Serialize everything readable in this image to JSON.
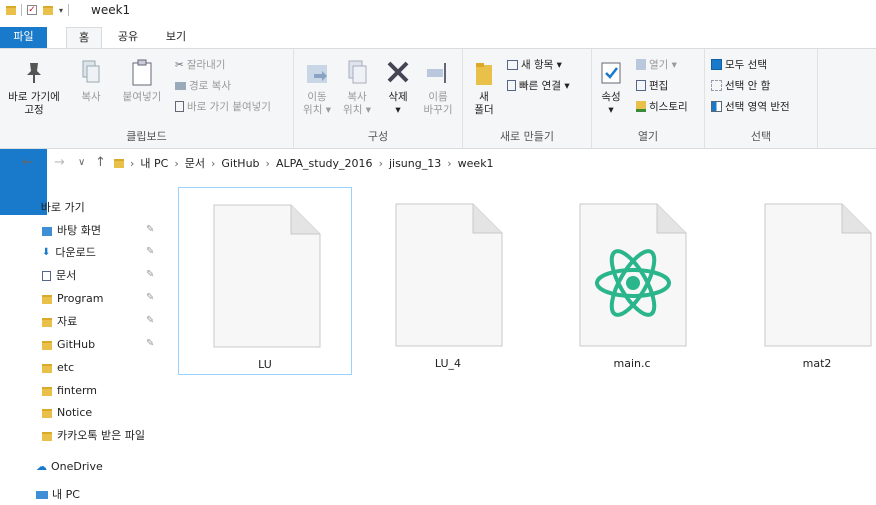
{
  "window": {
    "title": "week1"
  },
  "tabs": [
    {
      "label": "파일",
      "active": false
    },
    {
      "label": "홈",
      "active": true
    },
    {
      "label": "공유",
      "active": false
    },
    {
      "label": "보기",
      "active": false
    }
  ],
  "ribbon": {
    "clipboard": {
      "label": "클립보드",
      "pin_label_1": "바로 가기에",
      "pin_label_2": "고정",
      "copy": "복사",
      "paste": "붙여넣기",
      "cut": "잘라내기",
      "copy_path": "경로 복사",
      "paste_shortcut": "바로 가기 붙여넣기"
    },
    "organize": {
      "label": "구성",
      "move_1": "이동",
      "move_2": "위치 ▾",
      "copyto_1": "복사",
      "copyto_2": "위치 ▾",
      "delete_1": "삭제",
      "delete_2": "▾",
      "rename_1": "이름",
      "rename_2": "바꾸기"
    },
    "new": {
      "label": "새로 만들기",
      "new_item": "새 항목 ▾",
      "easy_access": "빠른 연결 ▾",
      "new_folder_1": "새",
      "new_folder_2": "폴더"
    },
    "open": {
      "label": "열기",
      "properties_1": "속성",
      "properties_2": "▾",
      "open": "열기 ▾",
      "edit": "편집",
      "history": "히스토리"
    },
    "select": {
      "label": "선택",
      "select_all": "모두 선택",
      "select_none": "선택 안 함",
      "invert": "선택 영역 반전"
    }
  },
  "address": {
    "crumbs": [
      "내 PC",
      "문서",
      "GitHub",
      "ALPA_study_2016",
      "jisung_13",
      "week1"
    ]
  },
  "sidebar": {
    "quick_access": "바로 가기",
    "items": [
      {
        "label": "바탕 화면",
        "pinned": true
      },
      {
        "label": "다운로드",
        "pinned": true
      },
      {
        "label": "문서",
        "pinned": true
      },
      {
        "label": "Program",
        "pinned": true
      },
      {
        "label": "자료",
        "pinned": true
      },
      {
        "label": "GitHub",
        "pinned": true
      },
      {
        "label": "etc",
        "pinned": false
      },
      {
        "label": "finterm",
        "pinned": false
      },
      {
        "label": "Notice",
        "pinned": false
      },
      {
        "label": "카카오톡 받은 파일",
        "pinned": false
      }
    ],
    "onedrive": "OneDrive",
    "this_pc": "내 PC"
  },
  "files": [
    {
      "name": "LU",
      "icon": "blank-file-icon",
      "selected": true
    },
    {
      "name": "LU_4",
      "icon": "blank-file-icon",
      "selected": false
    },
    {
      "name": "main.c",
      "icon": "atom-file-icon",
      "selected": false
    },
    {
      "name": "mat2",
      "icon": "blank-file-icon",
      "selected": false
    }
  ],
  "colors": {
    "accent": "#1979ca",
    "atom_green": "#2bb58a",
    "folder": "#e8c04a"
  }
}
